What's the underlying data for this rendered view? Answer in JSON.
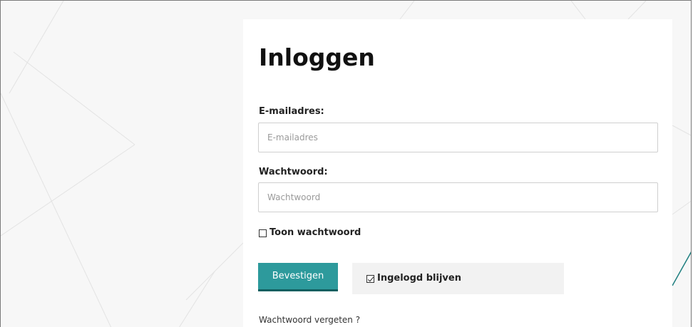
{
  "login": {
    "title": "Inloggen",
    "email_label": "E-mailadres:",
    "email_placeholder": "E-mailadres",
    "email_value": "",
    "password_label": "Wachtwoord:",
    "password_placeholder": "Wachtwoord",
    "password_value": "",
    "show_password_label": "Toon wachtwoord",
    "show_password_checked": false,
    "submit_label": "Bevestigen",
    "remember_label": "Ingelogd blijven",
    "remember_checked": true,
    "forgot_label": "Wachtwoord vergeten ?"
  },
  "colors": {
    "accent": "#2d9a9c",
    "accent_dark": "#0f5f60",
    "background": "#f7f7f7"
  }
}
